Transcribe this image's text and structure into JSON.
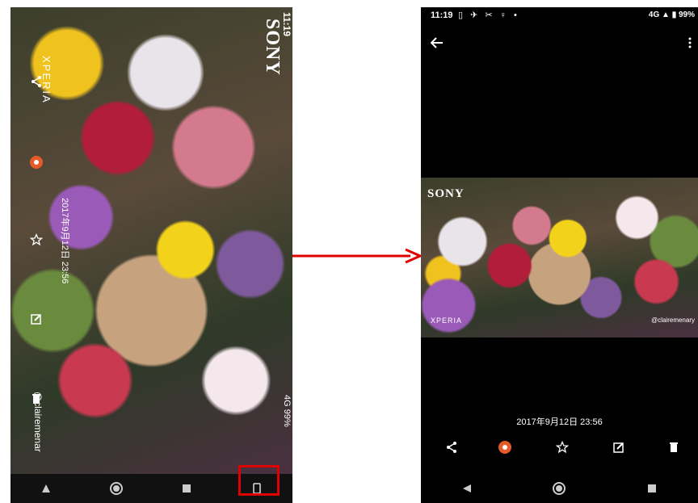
{
  "left_phone": {
    "status": {
      "time": "11:19",
      "network": "4G",
      "battery": "99%"
    },
    "brand_logo": "SONY",
    "xperia_logo": "XPERIA",
    "date": "2017年9月12日 23:56",
    "watermark": "@clairemenar",
    "actions": [
      "share-icon",
      "sketch-icon",
      "star-icon",
      "edit-icon",
      "delete-icon"
    ],
    "nav": [
      "back",
      "home",
      "recents",
      "rotate"
    ]
  },
  "right_phone": {
    "status": {
      "time": "11:19",
      "network": "4G",
      "battery": "99%"
    },
    "brand_logo": "SONY",
    "xperia_logo": "XPERIA",
    "watermark": "@clairemenary",
    "date": "2017年9月12日 23:56",
    "toolbar": [
      "share-icon",
      "sketch-icon",
      "star-icon",
      "edit-icon",
      "delete-icon"
    ],
    "nav": [
      "back",
      "home",
      "recents"
    ]
  },
  "annotation": {
    "arrow_color": "#e00000",
    "highlight_color": "#e00000"
  }
}
